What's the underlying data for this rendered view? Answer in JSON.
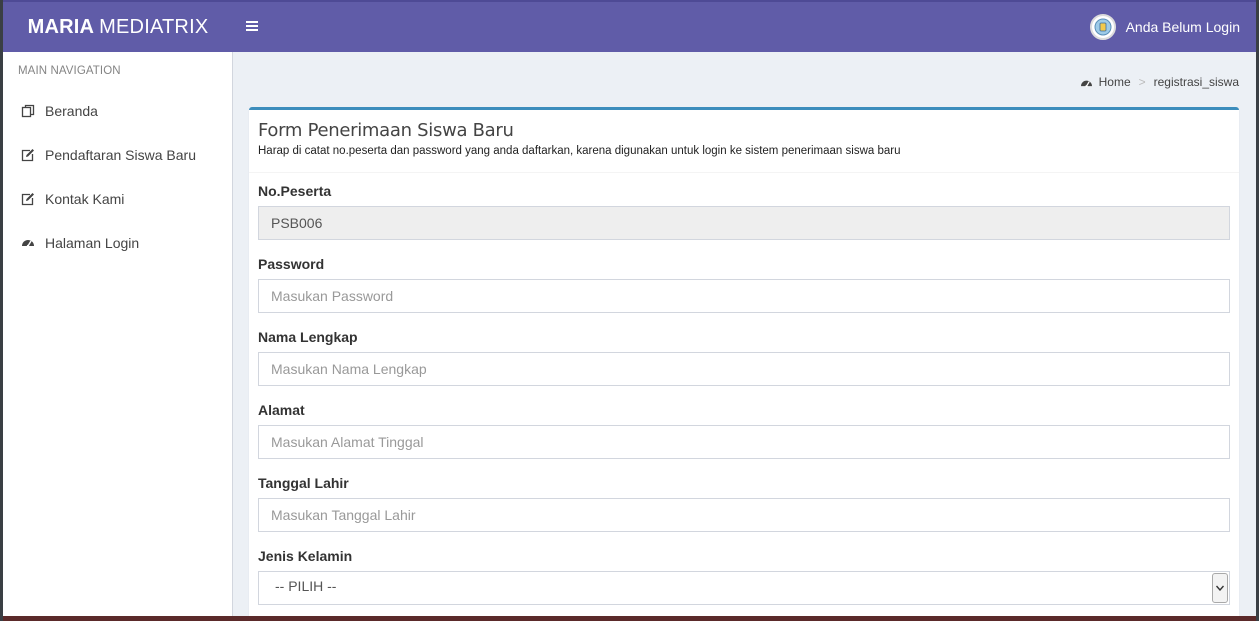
{
  "header": {
    "brand_bold": "MARIA",
    "brand_light": "MEDIATRIX",
    "user_label": "Anda Belum Login",
    "accent_color": "#605ca8"
  },
  "sidebar": {
    "header": "MAIN NAVIGATION",
    "items": [
      {
        "label": "Beranda",
        "icon": "copy-icon"
      },
      {
        "label": "Pendaftaran Siswa Baru",
        "icon": "edit-icon"
      },
      {
        "label": "Kontak Kami",
        "icon": "edit-icon"
      },
      {
        "label": "Halaman Login",
        "icon": "dashboard-icon"
      }
    ]
  },
  "breadcrumb": {
    "home": "Home",
    "current": "registrasi_siswa"
  },
  "form": {
    "title": "Form Penerimaan Siswa Baru",
    "subtitle": "Harap di catat no.peserta dan password yang anda daftarkan, karena digunakan untuk login ke sistem penerimaan siswa baru",
    "fields": {
      "no_peserta": {
        "label": "No.Peserta",
        "value": "PSB006"
      },
      "password": {
        "label": "Password",
        "placeholder": "Masukan Password"
      },
      "nama": {
        "label": "Nama Lengkap",
        "placeholder": "Masukan Nama Lengkap"
      },
      "alamat": {
        "label": "Alamat",
        "placeholder": "Masukan Alamat Tinggal"
      },
      "tanggal_lahir": {
        "label": "Tanggal Lahir",
        "placeholder": "Masukan Tanggal Lahir"
      },
      "jenis_kelamin": {
        "label": "Jenis Kelamin",
        "selected": "-- PILIH --"
      }
    }
  }
}
